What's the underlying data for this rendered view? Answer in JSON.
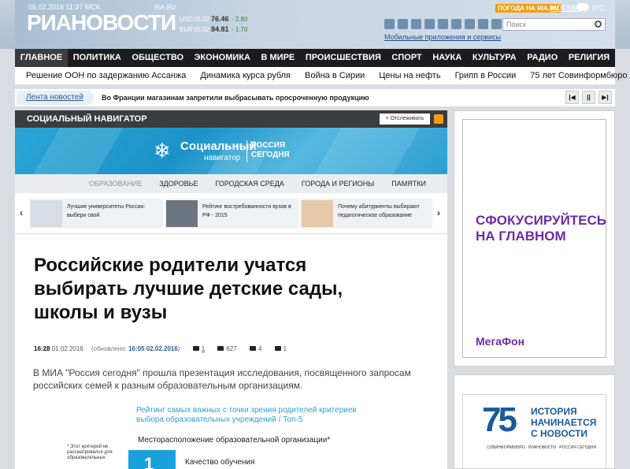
{
  "header": {
    "date": "05.02.2016 11:37 МСК",
    "logo": "РИАНОВОСТИ",
    "logo_tag": "RIA.RU",
    "rates": [
      {
        "currency": "USD",
        "date": "05.02",
        "value": "76.46",
        "change": "- 2.80"
      },
      {
        "currency": "EUR",
        "date": "05.02",
        "value": "84.81",
        "change": "- 1.70"
      }
    ],
    "apps_link": "Мобильные приложения и сервисы",
    "weather_link": "ПОГОДА НА RIA.RU",
    "city": "МОСКВА",
    "temperature": "0°С",
    "search_placeholder": "Поиск"
  },
  "nav": {
    "items": [
      "ГЛАВНОЕ",
      "ПОЛИТИКА",
      "ОБЩЕСТВО",
      "ЭКОНОМИКА",
      "В МИРЕ",
      "ПРОИСШЕСТВИЯ",
      "СПОРТ",
      "НАУКА",
      "КУЛЬТУРА",
      "РАДИО",
      "РЕЛИГИЯ"
    ]
  },
  "subnav": {
    "items": [
      "Решение ООН по задержанию Ассанжа",
      "Динамика курса рубля",
      "Война в Сирии",
      "Цены на нефть",
      "Грипп в России",
      "75 лет Совинформбюро"
    ]
  },
  "ticker": {
    "label": "Лента новостей",
    "text": "Во Франции магазинам запретили выбрасывать просроченную продукцию"
  },
  "section": {
    "title": "СОЦИАЛЬНЫЙ НАВИГАТОР",
    "follow": "+ Отслеживать",
    "banner": {
      "line1": "Социальный",
      "line2": "навигатор",
      "line3": "РОССИЯ",
      "line4": "СЕГОДНЯ"
    },
    "categories": [
      "ОБРАЗОВАНИЕ",
      "ЗДОРОВЬЕ",
      "ГОРОДСКАЯ СРЕДА",
      "ГОРОДА И РЕГИОНЫ",
      "ПАМЯТКИ"
    ],
    "cards": [
      "Лучшие университеты России: выбери свой",
      "Рейтинг востребованности вузов в РФ - 2015",
      "Почему абитуриенты выбирают педагогическое образование"
    ]
  },
  "article": {
    "headline": "Российские родители учатся выбирать лучшие детские сады, школы и вузы",
    "time": "16:28",
    "date": "01.02.2016",
    "updated_label": "(обновлено:",
    "updated_value": "16:05 02.02.2016",
    "updated_close": ")",
    "comments": "1",
    "views": "627",
    "likes": "4",
    "shares": "1",
    "lead": "В МИА \"Россия сегодня\" прошла презентация исследования, посвященного запросам российских семей к разным образовательным организациям.",
    "infographic": {
      "title": "Рейтинг самых важных с точки зрения родителей критериев выбора образовательных учреждений / Топ-5",
      "subtitle": "Месторасположение образовательной организации*",
      "note": "* Этот критерий не рассматривался для образовательных",
      "rank": "1",
      "item1": "Качество обучения"
    }
  },
  "ads": {
    "megafon_slogan": "СФОКУСИРУЙТЕСЬ НА ГЛАВНОМ",
    "megafon_brand": "МегаФон",
    "ad2_number": "75",
    "ad2_text": "ИСТОРИЯ НАЧИНАЕТСЯ С НОВОСТИ",
    "ad2_logos": "СОВИНФОРМБЮРО · РИАНОВОСТИ · РОССИЯ СЕГОДНЯ"
  }
}
